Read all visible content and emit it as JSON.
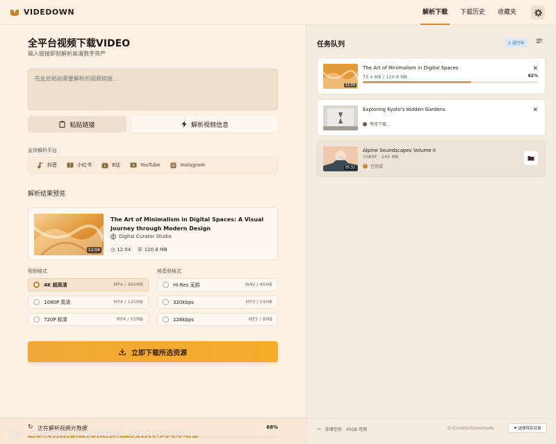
{
  "header": {
    "brand": "VIDEDOWN",
    "nav": [
      {
        "label": "解析下载",
        "active": true
      },
      {
        "label": "下载历史",
        "active": false
      },
      {
        "label": "收藏夹",
        "active": false
      }
    ],
    "settings_icon": "gear-icon"
  },
  "main": {
    "title": "全平台视频下载VIDEO",
    "subtitle": "输入链接即刻解析高清数字资产",
    "url_placeholder": "在此处粘贴需要解析的视频链接...",
    "paste_label": "粘贴链接",
    "parse_label": "解析视频信息",
    "platforms_label": "支持解析平台",
    "platforms": [
      {
        "label": "抖音",
        "icon": "music-note-icon"
      },
      {
        "label": "小红书",
        "icon": "book-icon"
      },
      {
        "label": "B站",
        "icon": "tv-icon"
      },
      {
        "label": "YouTube",
        "icon": "play-icon"
      },
      {
        "label": "Instagram",
        "icon": "camera-icon"
      }
    ],
    "preview_label": "解析结果预览",
    "preview": {
      "title": "The Art of Minimalism in Digital Spaces: A Visual Journey through Modern Design",
      "channel": "Digital Curator Studio",
      "duration": "12:04",
      "duration_meta": "12:04",
      "size": "120.8 MB"
    },
    "video_format_label": "视频格式",
    "audio_format_label": "纯音频格式",
    "video_formats": [
      {
        "label": "4K 超高清",
        "spec": "MP4 / 450MB",
        "selected": true
      },
      {
        "label": "1080P 高清",
        "spec": "MP4 / 120MB",
        "selected": false
      },
      {
        "label": "720P 标清",
        "spec": "MP4 / 65MB",
        "selected": false
      }
    ],
    "audio_formats": [
      {
        "label": "Hi-Res 无损",
        "spec": "WAV / 45MB",
        "selected": false
      },
      {
        "label": "320kbps",
        "spec": "MP3 / 24MB",
        "selected": false
      },
      {
        "label": "128kbps",
        "spec": "MP3 / 8MB",
        "selected": false
      }
    ],
    "download_label": "立即下载所选资源"
  },
  "bottom_bar": {
    "text": "正在解析视频元数据",
    "percent": "68%",
    "progress": 0.68
  },
  "queue": {
    "title": "任务队列",
    "badge": "2 进行中",
    "tasks": [
      {
        "title": "The Art of Minimalism in Digital Spaces",
        "duration": "12:04",
        "sub": "75.4 MB / 120.8 MB",
        "percent": "62%",
        "progress": 0.62,
        "status": "downloading"
      },
      {
        "title": "Exploring Kyoto's Hidden Gardens",
        "status_text": "等待下载...",
        "status": "waiting"
      },
      {
        "title": "Alpine Soundscapes Volume II",
        "duration": "05:32",
        "sub": "1080P · 245 MB",
        "status_text": "已完成",
        "status": "done"
      }
    ],
    "storage_label": "存储空间",
    "storage_value": "45GB 可用",
    "path": "D:/Curator/Downloads",
    "path_button": "选择保存目录"
  },
  "watermark": "TG: 互联网从业者充电站 @https1024",
  "colors": {
    "accent": "#d28a2d",
    "download_button": "#f4aa32",
    "background": "#fdf1e6"
  }
}
